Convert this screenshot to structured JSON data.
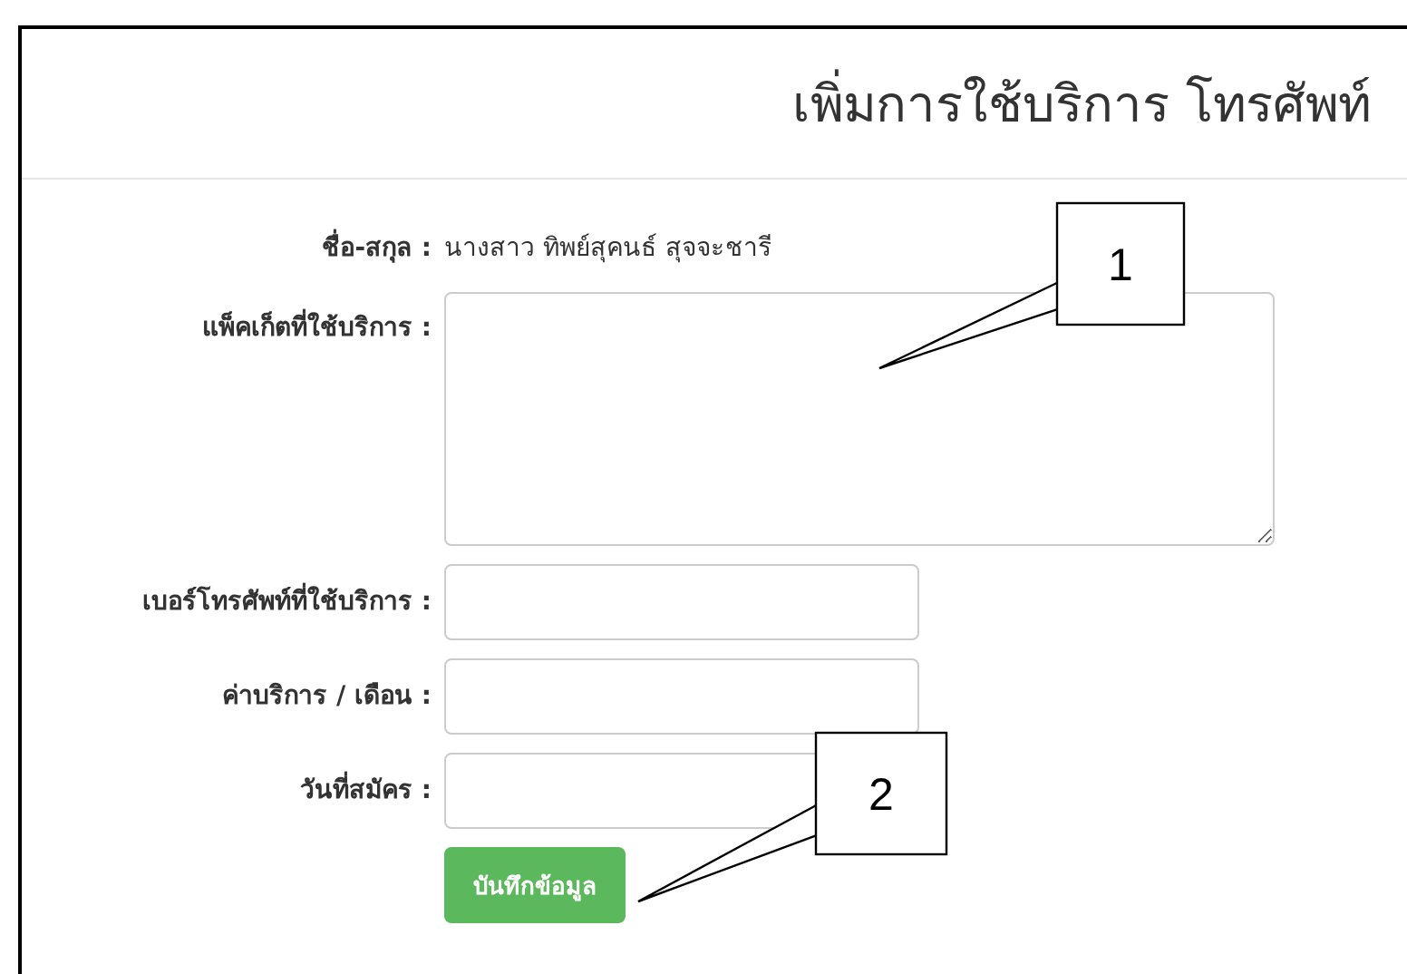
{
  "title": "เพิ่มการใช้บริการ โทรศัพท์",
  "fields": [
    {
      "kind": "text",
      "label": "ชื่อ-สกุล :",
      "value": "นางสาว ทิพย์สุคนธ์ สุจจะชารี"
    },
    {
      "kind": "textarea",
      "label": "แพ็คเก็ตที่ใช้บริการ :"
    },
    {
      "kind": "input",
      "label": "เบอร์โทรศัพท์ที่ใช้บริการ :"
    },
    {
      "kind": "input",
      "label": "ค่าบริการ / เดือน :"
    },
    {
      "kind": "input",
      "label": "วันที่สมัคร :"
    }
  ],
  "button": "บันทึกข้อมูล",
  "callouts": [
    "1",
    "2"
  ]
}
